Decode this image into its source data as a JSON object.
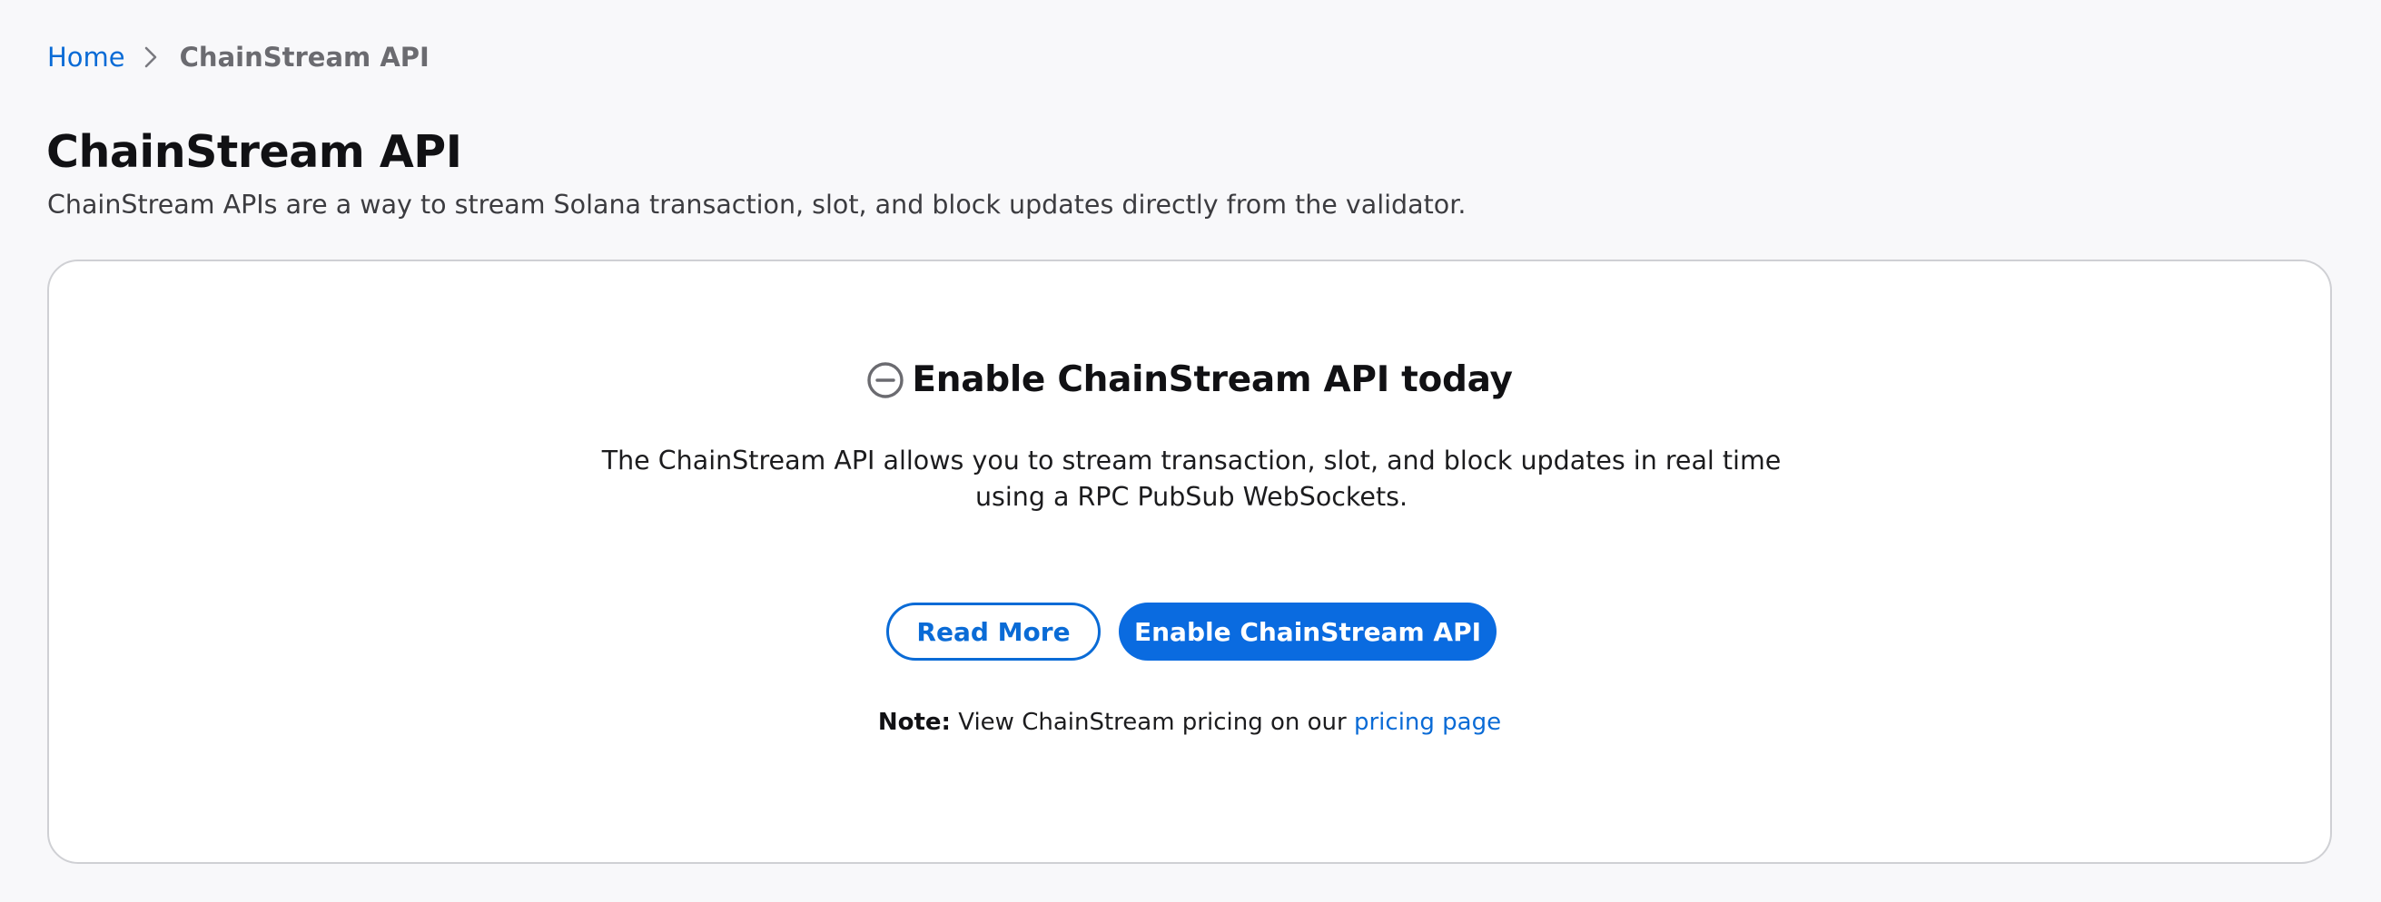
{
  "breadcrumb": {
    "home_label": "Home",
    "current_label": "ChainStream API"
  },
  "header": {
    "title": "ChainStream API",
    "subtitle": "ChainStream APIs are a way to stream Solana transaction, slot, and block updates directly from the validator."
  },
  "card": {
    "status_icon": "minus-circle-icon",
    "title": "Enable ChainStream API today",
    "description": "The ChainStream API allows you to stream transaction, slot, and block updates in real time using a RPC PubSub WebSockets.",
    "read_more_label": "Read More",
    "enable_label": "Enable ChainStream API",
    "note_label": "Note:",
    "note_text": "View ChainStream pricing on our",
    "note_link_label": "pricing page"
  },
  "colors": {
    "accent": "#0a6be0",
    "link": "#0a6bd6",
    "background": "#f8f8fa"
  }
}
